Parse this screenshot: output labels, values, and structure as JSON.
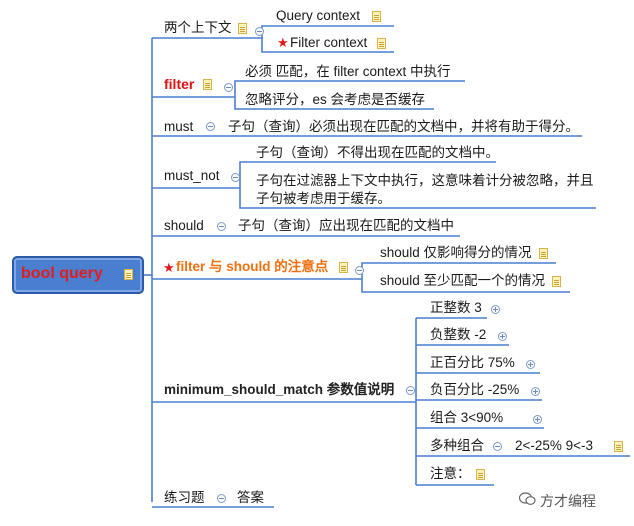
{
  "root": {
    "label": "bool query"
  },
  "branches": {
    "contexts": {
      "label": "两个上下文",
      "children": [
        "Query context",
        "Filter context"
      ]
    },
    "filter": {
      "label": "filter",
      "children": [
        "必须 匹配，在 filter context 中执行",
        "忽略评分，es 会考虑是否缓存"
      ]
    },
    "must": {
      "label": "must",
      "child": "子句（查询）必须出现在匹配的文档中，并将有助于得分。"
    },
    "must_not": {
      "label": "must_not",
      "children": [
        "子句（查询）不得出现在匹配的文档中。",
        "子句在过滤器上下文中执行，这意味着计分被忽略，并且",
        "子句被考虑用于缓存。"
      ]
    },
    "should": {
      "label": "should",
      "child": "子句（查询）应出现在匹配的文档中"
    },
    "filter_should": {
      "label": "filter 与 should 的注意点",
      "children": [
        "should 仅影响得分的情况",
        "should 至少匹配一个的情况"
      ]
    },
    "msm": {
      "label": "minimum_should_match 参数值说明",
      "children": [
        "正整数 3",
        "负整数 -2",
        "正百分比 75%",
        "负百分比 -25%",
        "组合 3<90%",
        "多种组合",
        "注意："
      ],
      "multi_combo": "2<-25%  9<-3"
    },
    "exercise": {
      "label": "练习题",
      "child": "答案"
    }
  },
  "watermark": "方才编程",
  "colors": {
    "line": "#4a7fd0",
    "root_fill": "#4a7fd0",
    "accent_red": "#e01010",
    "accent_orange": "#f07010"
  }
}
